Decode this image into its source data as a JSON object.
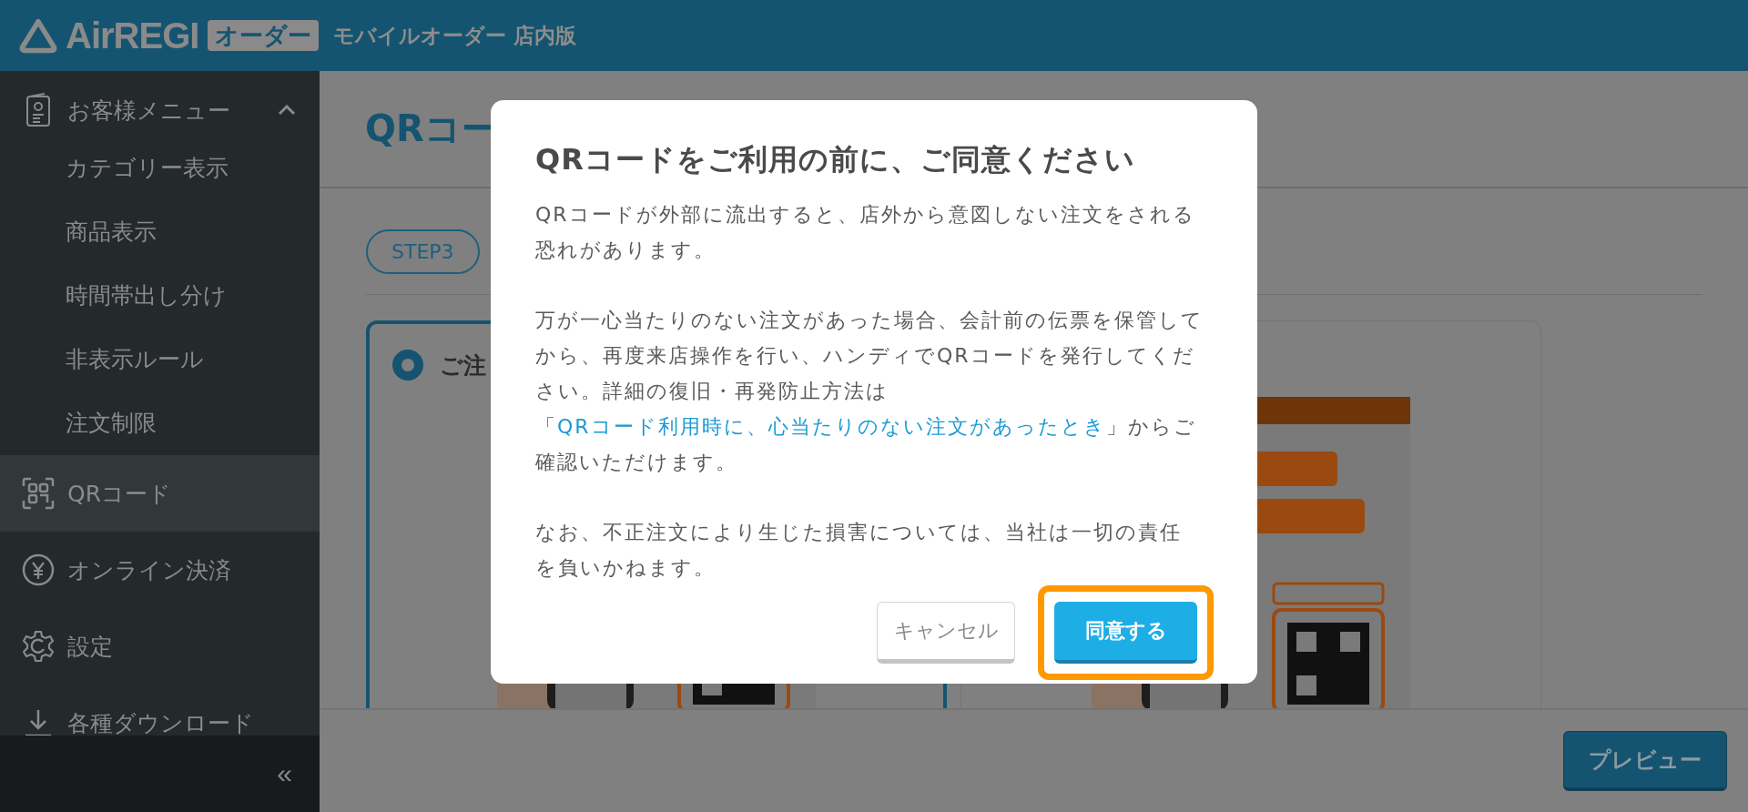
{
  "header": {
    "logo": "AirREGI",
    "logo_badge": "オーダー",
    "subtitle": "モバイルオーダー 店内版"
  },
  "sidebar": {
    "items": [
      {
        "label": "お客様メニュー",
        "kind": "group",
        "expanded": true,
        "selected": false,
        "children": [
          {
            "label": "カテゴリー表示",
            "selected": false
          },
          {
            "label": "商品表示",
            "selected": false
          },
          {
            "label": "時間帯出し分け",
            "selected": false
          },
          {
            "label": "非表示ルール",
            "selected": false
          },
          {
            "label": "注文制限",
            "selected": false
          }
        ]
      },
      {
        "label": "QRコード",
        "kind": "link",
        "selected": true
      },
      {
        "label": "オンライン決済",
        "kind": "link",
        "selected": false
      },
      {
        "label": "設定",
        "kind": "link",
        "selected": false
      },
      {
        "label": "各種ダウンロード",
        "kind": "link",
        "selected": false
      }
    ],
    "collapse_button": "«"
  },
  "page": {
    "title": "QRコー",
    "step": "STEP3",
    "cards": [
      {
        "label": "ご注",
        "selected": true,
        "kind": "picture"
      },
      {
        "kind": "picture"
      }
    ],
    "preview_button": "プレビュー"
  },
  "dialog": {
    "title": "QRコードをご利用の前に、ご同意ください",
    "paragraphs": [
      [
        {
          "text": "QRコードが外部に流出すると、店外から意図しない注文をされる恐れがあります。"
        }
      ],
      [
        {
          "text": "万が一心当たりのない注文があった場合、会計前の伝票を保管してから、再度来店操作を行い、ハンディでQRコードを発行してください。詳細の復旧・再発防止方法は「"
        },
        {
          "text": "QRコード利用時に、心当たりのない注文があったとき",
          "kind": "link"
        },
        {
          "text": "」からご確認いただけます。"
        }
      ],
      [
        {
          "text": "なお、不正注文により生じた損害については、当社は一切の責任を負いかねます。"
        }
      ]
    ],
    "cancel_button": "キャンセル",
    "confirm_button": "同意する",
    "confirm_highlighted": true
  }
}
